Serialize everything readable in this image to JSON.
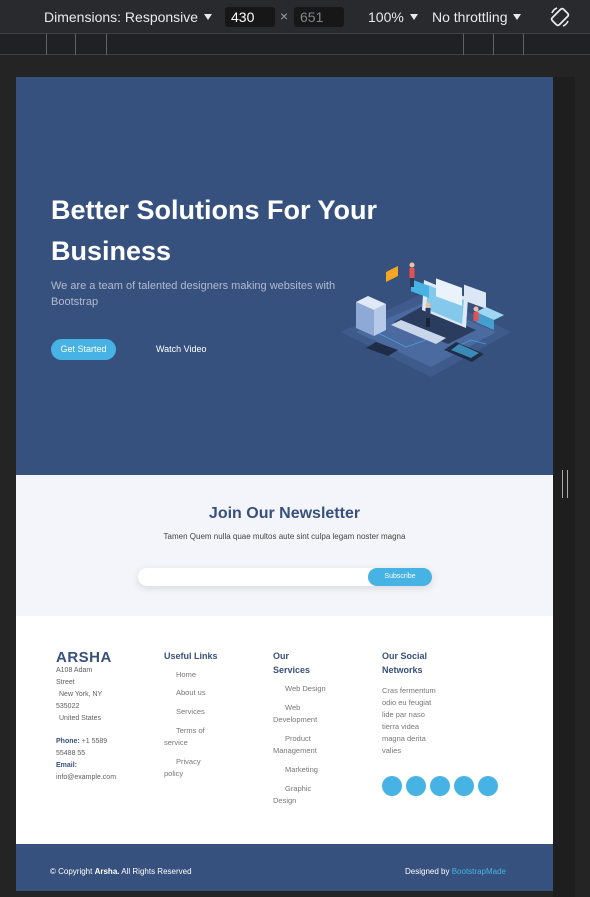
{
  "devtools": {
    "dimensions_label": "Dimensions: Responsive",
    "width": "430",
    "times": "×",
    "height": "651",
    "zoom": "100%",
    "throttle": "No throttling"
  },
  "hero": {
    "title": "Better Solutions For Your Business",
    "subtitle": "We are a team of talented designers making websites with Bootstrap",
    "get_started": "Get Started",
    "watch_video": "Watch Video"
  },
  "newsletter": {
    "title": "Join Our Newsletter",
    "description": "Tamen Quem nulla quae multos aute sint culpa legam noster magna",
    "email_value": "",
    "subscribe": "Subscribe"
  },
  "footer": {
    "brand": "ARSHA",
    "address_lines": [
      "A108 Adam",
      "Street",
      "New York, NY",
      "535022",
      "United States"
    ],
    "phone_label": "Phone:",
    "phone_value": "+1 5589 55488 55",
    "email_label": "Email:",
    "email_value": "info@example.com",
    "useful_links_title": "Useful Links",
    "useful_links": [
      "Home",
      "About us",
      "Services",
      "Terms of service",
      "Privacy policy"
    ],
    "services_title": "Our Services",
    "services": [
      "Web Design",
      "Web Development",
      "Product Management",
      "Marketing",
      "Graphic Design"
    ],
    "social_title": "Our Social Networks",
    "social_text": "Cras fermentum odio eu feugiat lide par naso tierra videa magna derita valies",
    "social_icons": [
      "twitter-icon",
      "facebook-icon",
      "instagram-icon",
      "skype-icon",
      "linkedin-icon"
    ],
    "copyright_prefix": "© Copyright",
    "copyright_brand": "Arsha.",
    "copyright_suffix": "All Rights Reserved",
    "designed_by": "Designed by",
    "designer": "BootstrapMade"
  },
  "colors": {
    "primary": "#37517e",
    "accent": "#47b2e4",
    "light_bg": "#f3f5fa"
  }
}
